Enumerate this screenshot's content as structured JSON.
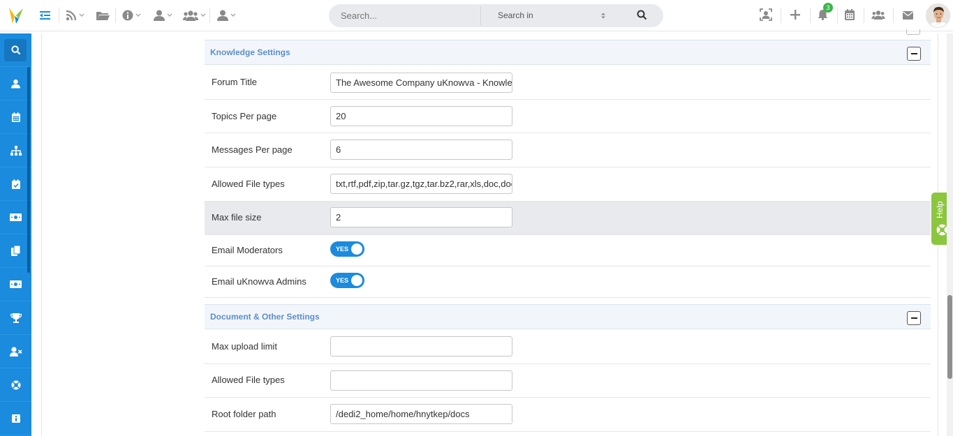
{
  "header": {
    "search_placeholder": "Search...",
    "search_in_label": "Search in",
    "notification_count": "3"
  },
  "colors": {
    "brand_blue": "#1a8bdd",
    "section_title": "#5d8ec9",
    "help_green": "#8cc63f",
    "badge_green": "#3cb54a"
  },
  "sidebar": {
    "items": [
      {
        "icon": "search-icon",
        "active": true
      },
      {
        "icon": "user-icon"
      },
      {
        "icon": "calendar-icon"
      },
      {
        "icon": "org-chart-icon"
      },
      {
        "icon": "calendar-check-icon"
      },
      {
        "icon": "money-icon"
      },
      {
        "icon": "copy-icon"
      },
      {
        "icon": "money-alt-icon"
      },
      {
        "icon": "trophy-icon"
      },
      {
        "icon": "user-times-icon"
      },
      {
        "icon": "support-icon"
      },
      {
        "icon": "info-icon"
      }
    ]
  },
  "sections": {
    "knowledge": {
      "title": "Knowledge Settings",
      "forum_title_label": "Forum Title",
      "forum_title_value": "The Awesome Company uKnowva - Knowled",
      "topics_label": "Topics Per page",
      "topics_value": "20",
      "messages_label": "Messages Per page",
      "messages_value": "6",
      "file_types_label": "Allowed File types",
      "file_types_value": "txt,rtf,pdf,zip,tar.gz,tgz,tar.bz2,rar,xls,doc,docx",
      "max_size_label": "Max file size",
      "max_size_value": "2",
      "email_mod_label": "Email Moderators",
      "email_mod_toggle": "YES",
      "email_admin_label": "Email uKnowva Admins",
      "email_admin_toggle": "YES"
    },
    "document": {
      "title": "Document & Other Settings",
      "max_upload_label": "Max upload limit",
      "max_upload_value": "",
      "file_types_label": "Allowed File types",
      "file_types_value": "",
      "root_path_label": "Root folder path",
      "root_path_value": "/dedi2_home/home/hnytkep/docs"
    }
  },
  "help": {
    "label": "Help"
  }
}
